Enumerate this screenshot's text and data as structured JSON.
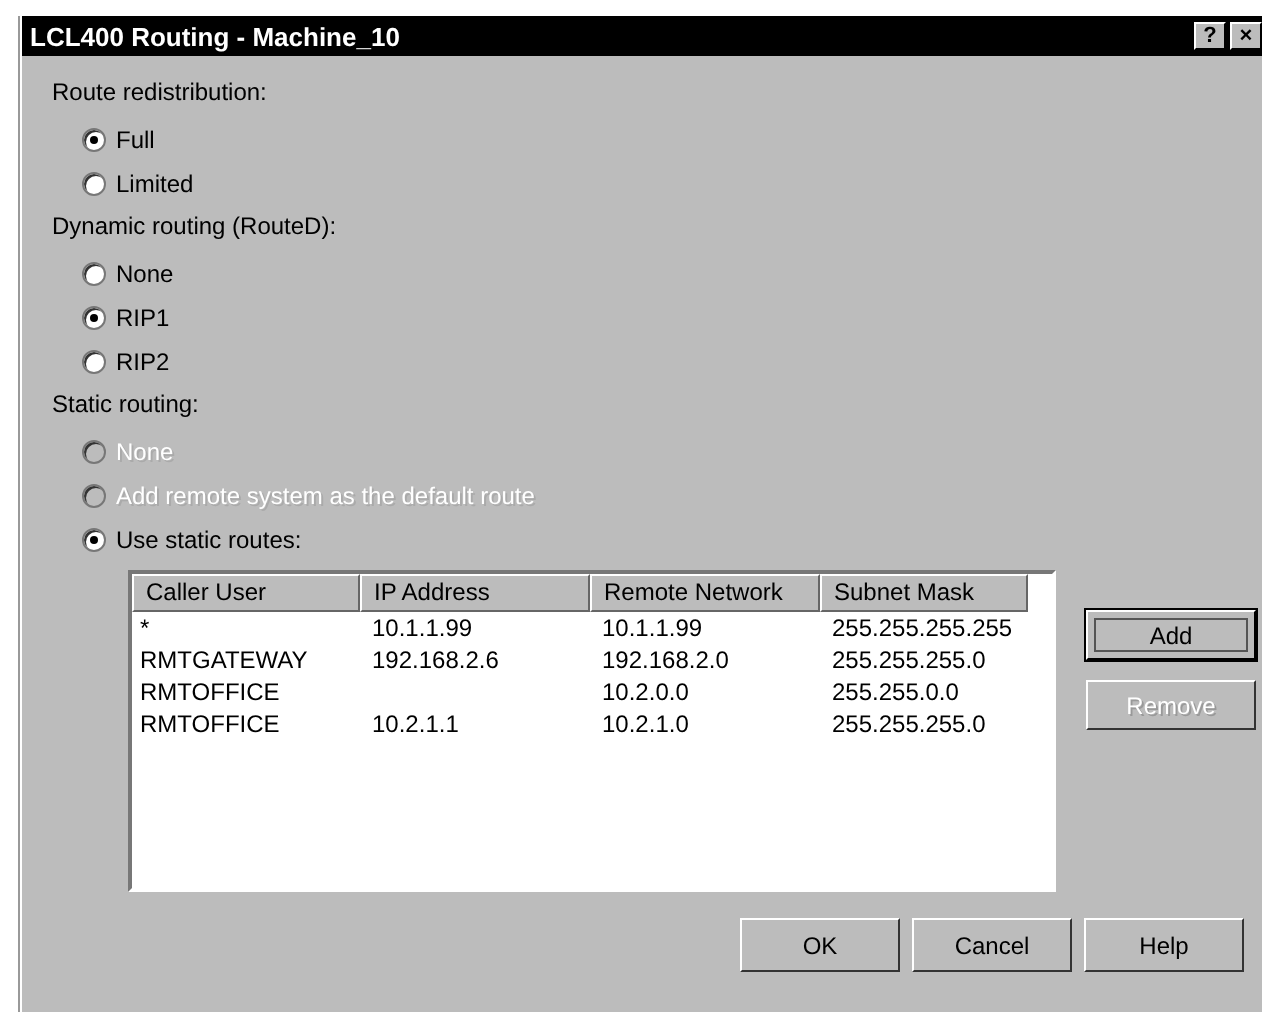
{
  "window": {
    "title": "LCL400 Routing - Machine_10",
    "title_buttons": [
      "?",
      "×"
    ]
  },
  "groups": [
    {
      "label": "Route redistribution:",
      "options": [
        {
          "label": "Full",
          "selected": true,
          "disabled": false
        },
        {
          "label": "Limited",
          "selected": false,
          "disabled": false
        }
      ]
    },
    {
      "label": "Dynamic routing (RouteD):",
      "options": [
        {
          "label": "None",
          "selected": false,
          "disabled": false
        },
        {
          "label": "RIP1",
          "selected": true,
          "disabled": false
        },
        {
          "label": "RIP2",
          "selected": false,
          "disabled": false
        }
      ]
    },
    {
      "label": "Static routing:",
      "options": [
        {
          "label": "None",
          "selected": false,
          "disabled": true
        },
        {
          "label": "Add remote system as the default route",
          "selected": false,
          "disabled": true
        },
        {
          "label": "Use static routes:",
          "selected": true,
          "disabled": false
        }
      ]
    }
  ],
  "table": {
    "columns": [
      "Caller User",
      "IP Address",
      "Remote Network",
      "Subnet Mask"
    ],
    "rows": [
      [
        "*",
        "10.1.1.99",
        "10.1.1.99",
        "255.255.255.255"
      ],
      [
        "RMTGATEWAY",
        "192.168.2.6",
        "192.168.2.0",
        "255.255.255.0"
      ],
      [
        "RMTOFFICE",
        "",
        "10.2.0.0",
        "255.255.0.0"
      ],
      [
        "RMTOFFICE",
        "10.2.1.1",
        "10.2.1.0",
        "255.255.255.0"
      ]
    ]
  },
  "side_buttons": [
    {
      "label": "Add",
      "disabled": false,
      "default": true
    },
    {
      "label": "Remove",
      "disabled": true,
      "default": false
    }
  ],
  "buttons": [
    "OK",
    "Cancel",
    "Help"
  ]
}
